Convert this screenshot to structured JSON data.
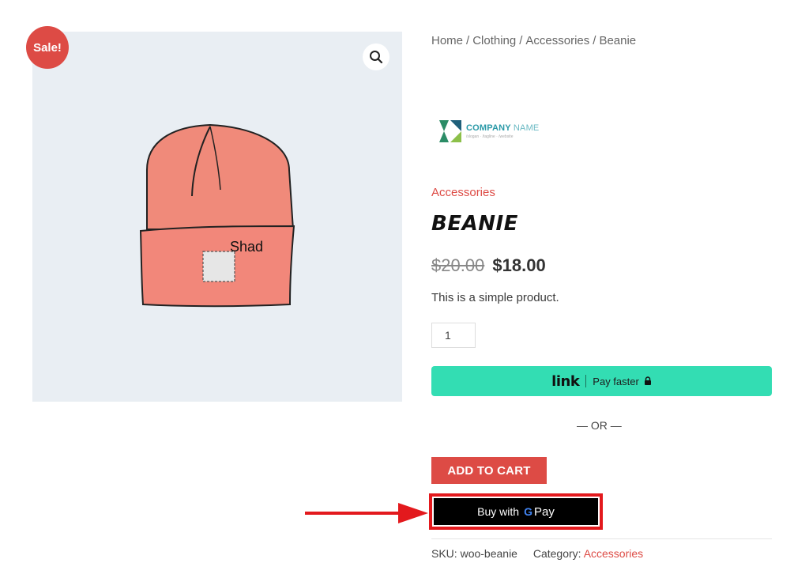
{
  "product": {
    "sale_badge": "Sale!",
    "image_text": "Shad",
    "zoom_icon": "search-icon"
  },
  "breadcrumb": {
    "items": [
      "Home",
      "Clothing",
      "Accessories",
      "Beanie"
    ],
    "separator": "/"
  },
  "brand": {
    "name_bold": "COMPANY",
    "name_light": "NAME",
    "tagline": "/slogan · /tagline · /website"
  },
  "category_label": "Accessories",
  "title": "BEANIE",
  "price": {
    "regular": "$20.00",
    "sale": "$18.00"
  },
  "short_description": "This is a simple product.",
  "quantity": "1",
  "link_pay": {
    "logo": "link",
    "label": "Pay faster"
  },
  "or_divider": "— OR —",
  "add_to_cart": "ADD TO CART",
  "gpay": {
    "prefix": "Buy with",
    "g": "G",
    "suffix": "Pay"
  },
  "meta": {
    "sku_label": "SKU:",
    "sku_value": "woo-beanie",
    "category_label": "Category:",
    "category_value": "Accessories"
  },
  "colors": {
    "accent": "#dd4b45",
    "link_green": "#33ddb3",
    "highlight_red": "#e3191d",
    "image_bg": "#e9eef3"
  }
}
